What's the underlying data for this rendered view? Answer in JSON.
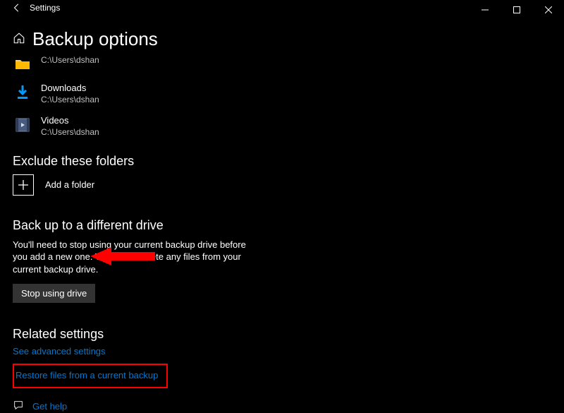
{
  "titlebar": {
    "app_name": "Settings"
  },
  "page": {
    "title": "Backup options"
  },
  "folders": [
    {
      "name": "",
      "path": "C:\\Users\\dshan",
      "kind": "folder"
    },
    {
      "name": "Downloads",
      "path": "C:\\Users\\dshan",
      "kind": "downloads"
    },
    {
      "name": "Videos",
      "path": "C:\\Users\\dshan",
      "kind": "videos"
    }
  ],
  "exclude": {
    "heading": "Exclude these folders",
    "add_label": "Add a folder"
  },
  "backup_diff": {
    "heading": "Back up to a different drive",
    "body": "You'll need to stop using your current backup drive before you add a new one. This won't delete any files from your current backup drive.",
    "button": "Stop using drive"
  },
  "related": {
    "heading": "Related settings",
    "links": {
      "advanced": "See advanced settings",
      "restore": "Restore files from a current backup"
    }
  },
  "help": {
    "label": "Get help"
  }
}
